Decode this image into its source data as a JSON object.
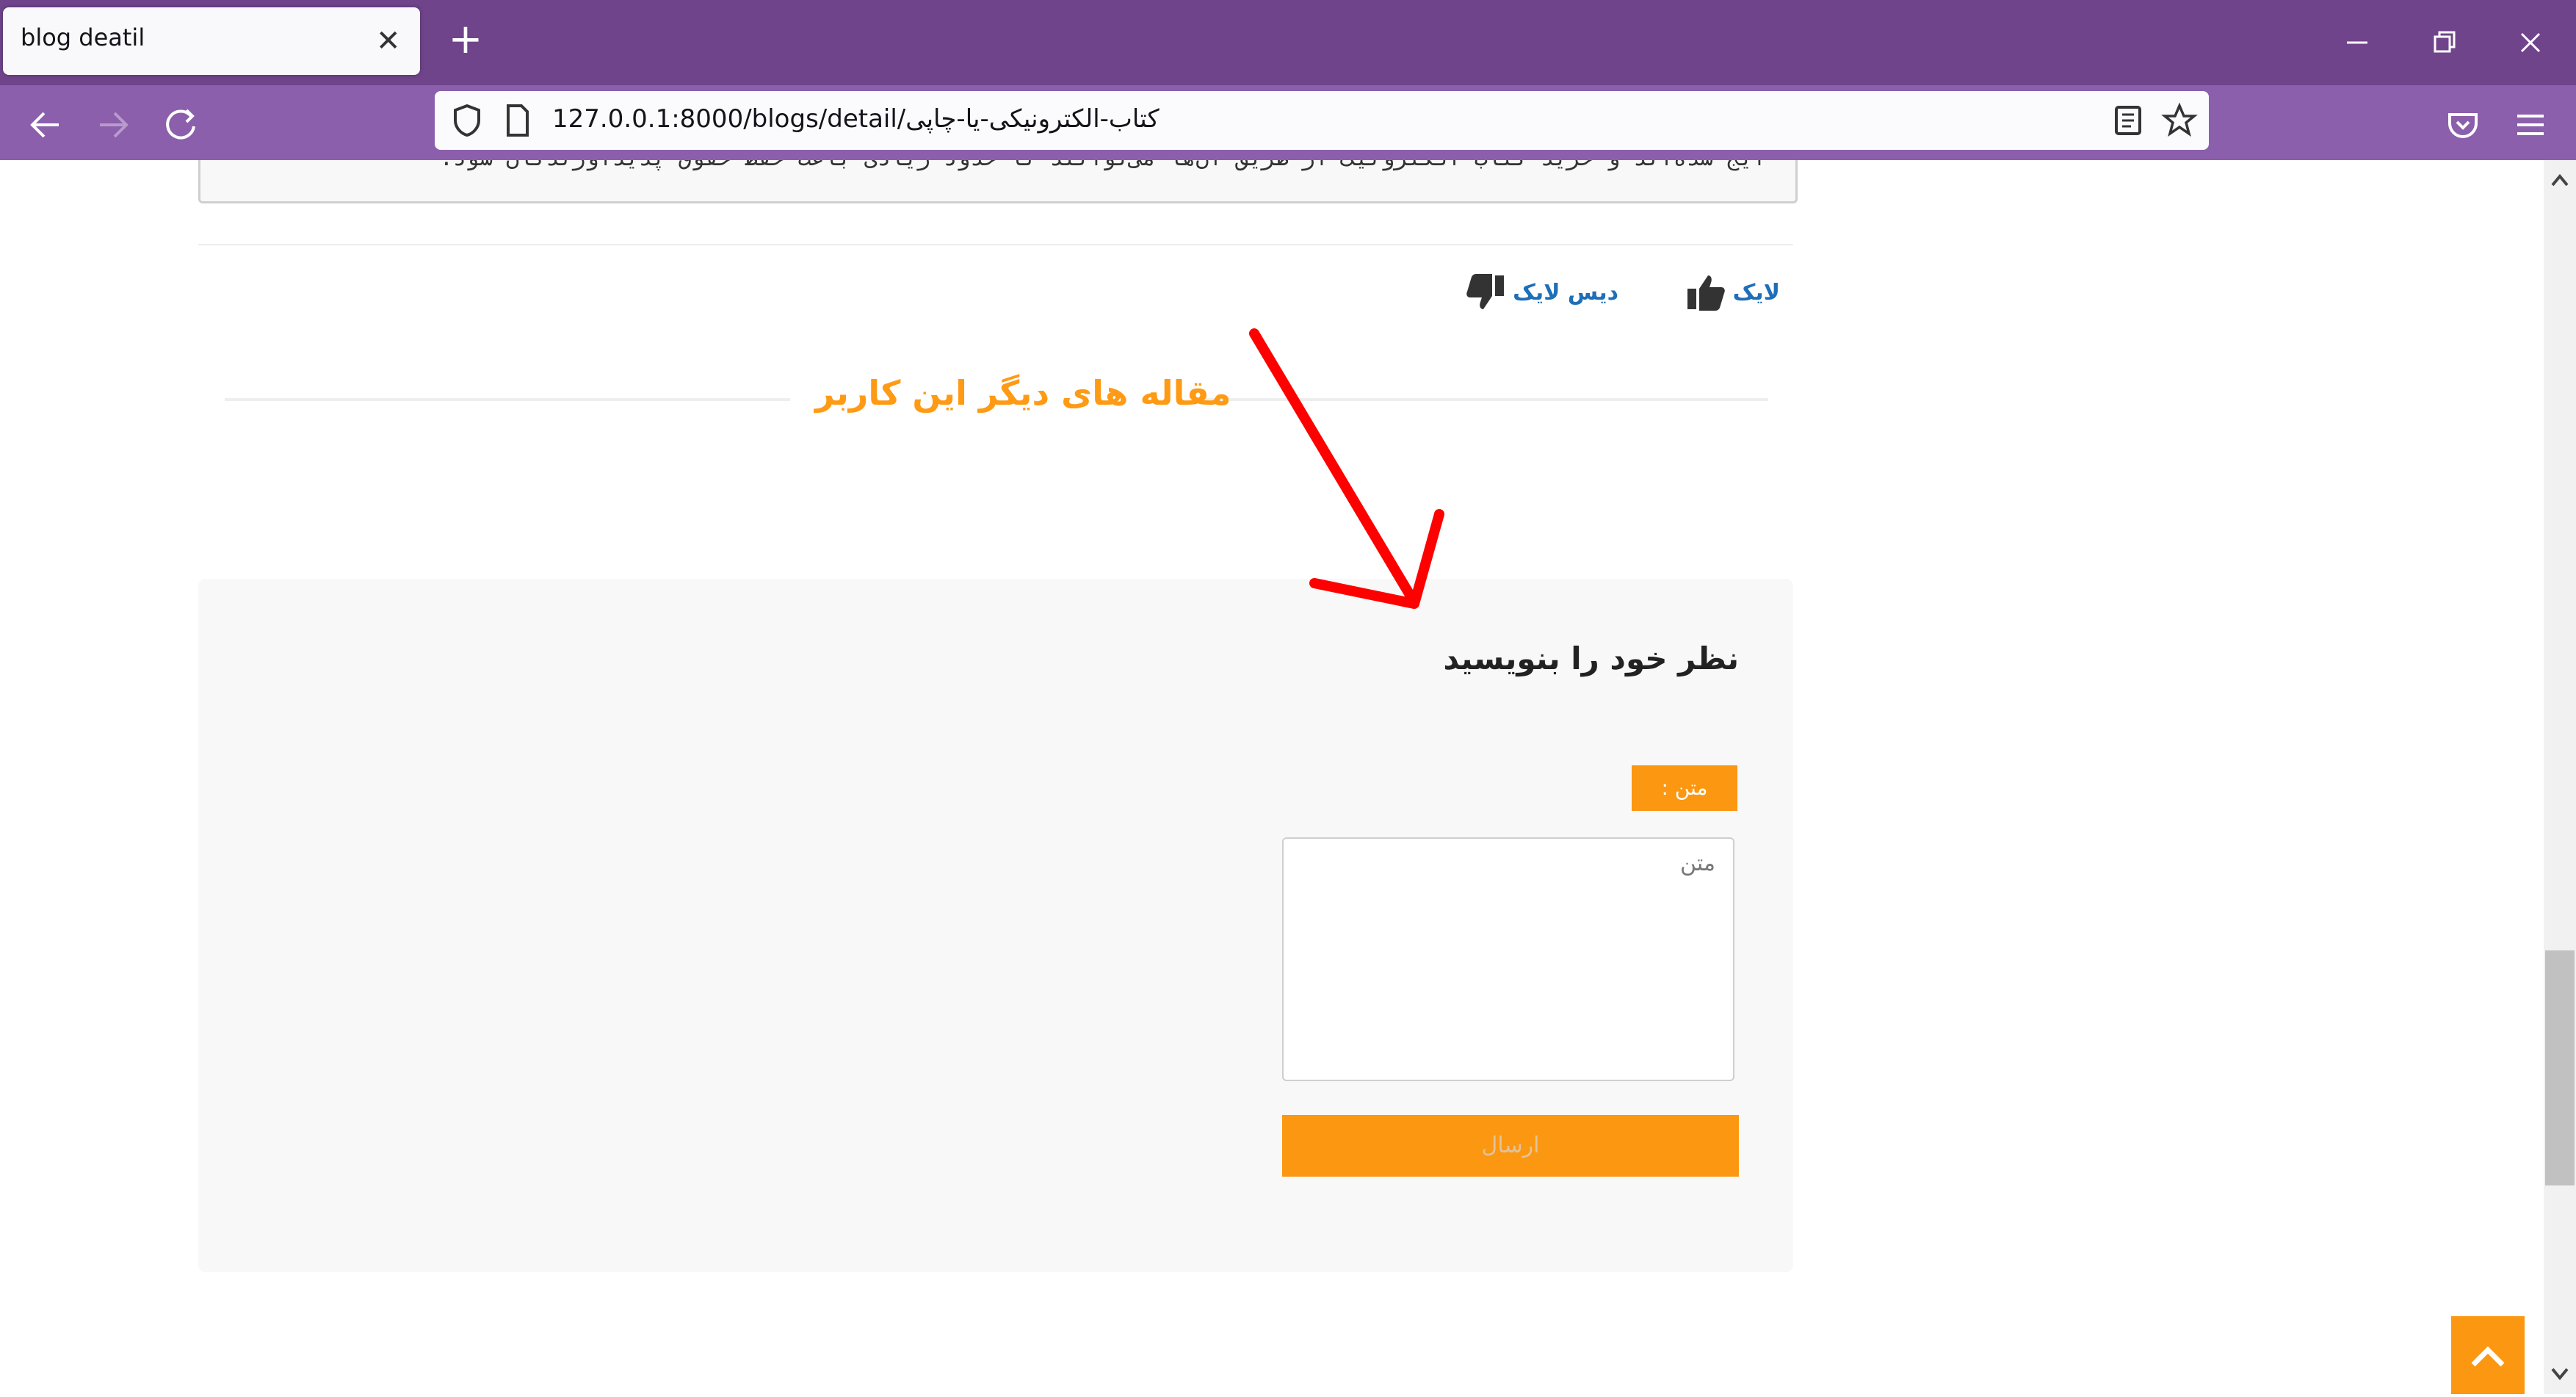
{
  "browser": {
    "tab_title": "blog deatil",
    "url": "127.0.0.1:8000/blogs/detail/کتاب-الکترونیکی-یا-چاپی"
  },
  "article": {
    "code_snippet": "ایج شده‌اند و خرید کتاب الکترونیک از طریق آن‌ها می‌توانند تا حدود زیادی باعث حفظ حقوق پدیدآورندگان شود."
  },
  "reactions": {
    "like_label": "لایک",
    "dislike_label": "دیس لایک"
  },
  "related": {
    "title": "مقاله های دیگر این کاربر"
  },
  "comment_form": {
    "heading": "نظر خود را بنویسید",
    "text_label": "متن :",
    "textarea_placeholder": "متن",
    "submit_label": "ارسال"
  },
  "colors": {
    "accent": "#fc9711",
    "browser_purple": "#70448b",
    "link_blue": "#1e6fb8",
    "annotation_red": "#ff0000"
  }
}
